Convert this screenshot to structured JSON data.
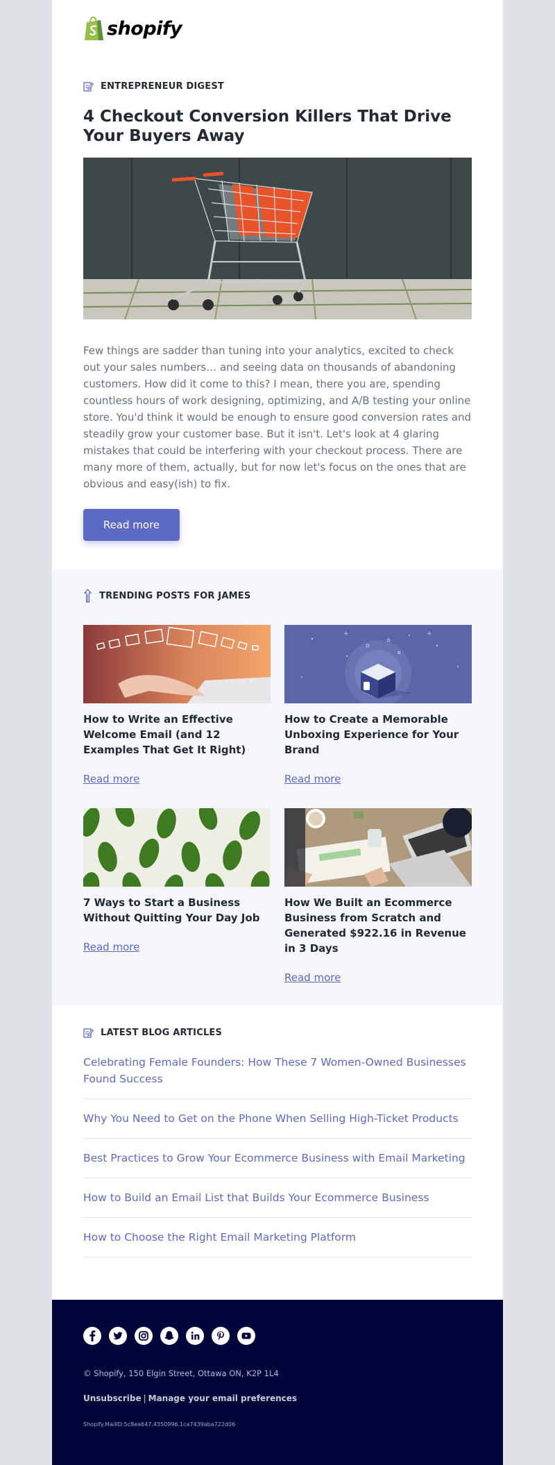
{
  "brand": {
    "name": "shopify",
    "accent": "#5c6ac4",
    "green": "#95bf47",
    "footer_bg": "#000639"
  },
  "feature": {
    "eyebrow": "ENTREPRENEUR DIGEST",
    "title": "4 Checkout Conversion Killers That Drive Your Buyers Away",
    "image_alt": "shopping carts",
    "body": "Few things are sadder than tuning into your analytics, excited to check out your sales numbers… and seeing data on thousands of abandoning customers. How did it come to this? I mean, there you are, spending countless hours of work designing, optimizing, and A/B testing your online store. You'd think it would be enough to ensure good conversion rates and steadily grow your customer base. But it isn't. Let's look at 4 glaring mistakes that could be interfering with your checkout process. There are many more of them, actually, but for now let's focus on the ones that are obvious and easy(ish) to fix.",
    "cta": "Read more"
  },
  "trending": {
    "eyebrow": "TRENDING POSTS FOR JAMES",
    "posts": [
      {
        "title": "How to Write an Effective Welcome Email (and 12 Examples That Get It Right)",
        "link": "Read more"
      },
      {
        "title": "How to Create a Memorable Unboxing Experience for Your Brand",
        "link": "Read more"
      },
      {
        "title": "7 Ways to Start a Business Without Quitting Your Day Job",
        "link": "Read more"
      },
      {
        "title": "How We Built an Ecommerce Business from Scratch and Generated $922.16 in Revenue in 3 Days",
        "link": "Read more"
      }
    ]
  },
  "latest": {
    "eyebrow": "LATEST BLOG ARTICLES",
    "articles": [
      "Celebrating Female Founders: How These 7 Women-Owned Businesses Found Success",
      "Why You Need to Get on the Phone When Selling High-Ticket Products",
      "Best Practices to Grow Your Ecommerce Business with Email Marketing",
      "How to Build an Email List that Builds Your Ecommerce Business",
      "How to Choose the Right Email Marketing Platform"
    ]
  },
  "footer": {
    "socials": [
      "facebook-icon",
      "twitter-icon",
      "instagram-icon",
      "snapchat-icon",
      "linkedin-icon",
      "pinterest-icon",
      "youtube-icon"
    ],
    "address": "© Shopify,  150 Elgin Street, Ottawa ON, K2P 1L4",
    "unsubscribe": "Unsubscribe",
    "separator": "|",
    "manage": "Manage your email preferences",
    "mail_id": "Shopify.MailID:5c8ea647.4350996.1ca7439aba722d06"
  }
}
